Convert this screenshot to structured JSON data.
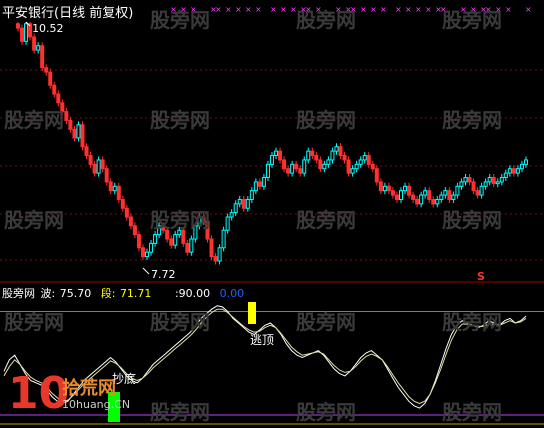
{
  "window": {
    "title": "平安银行(日线 前复权)"
  },
  "watermark": {
    "text": "股旁网"
  },
  "price_pane": {
    "high_label": "10.52",
    "low_label": "7.72",
    "marker_symbol": "S"
  },
  "indicator_bar": {
    "name": "股旁网",
    "wave_label": "波:",
    "wave_value": "75.70",
    "segment_label": "段:",
    "segment_value": "71.71",
    "level_high": ":90.00",
    "level_low": "0.00"
  },
  "annotations": {
    "top_signal": "逃顶",
    "bottom_signal": "抄底"
  },
  "brand": {
    "number": "10",
    "name": "拾荒网",
    "url": "10huang.CN"
  },
  "colors": {
    "background": "#000000",
    "up_candle": "#00ffff",
    "down_candle": "#ff3030",
    "separator": "#a00000",
    "level_line": "#c040ff",
    "wave_line": "#ffffff",
    "segment_line": "#e0e0a0",
    "top_marker": "#ffff00",
    "bottom_marker": "#00ff00",
    "dates_marker": "#ff40ff",
    "level_low_color": "#2060ff"
  },
  "chart_data": [
    {
      "type": "candlestick",
      "y_high": 10.52,
      "y_low": 7.72,
      "closes": [
        10.45,
        10.3,
        10.5,
        10.35,
        10.2,
        10.25,
        10.0,
        9.95,
        9.8,
        9.7,
        9.6,
        9.5,
        9.4,
        9.3,
        9.2,
        9.35,
        9.1,
        9.0,
        8.9,
        8.8,
        8.95,
        8.85,
        8.7,
        8.6,
        8.65,
        8.5,
        8.4,
        8.3,
        8.2,
        8.1,
        7.95,
        7.85,
        7.9,
        8.0,
        8.1,
        8.2,
        8.15,
        8.05,
        7.98,
        8.1,
        8.15,
        8.0,
        7.9,
        8.05,
        8.2,
        8.3,
        8.25,
        8.05,
        7.85,
        7.8,
        7.95,
        8.15,
        8.3,
        8.35,
        8.45,
        8.5,
        8.4,
        8.5,
        8.6,
        8.7,
        8.65,
        8.75,
        8.9,
        9.0,
        9.05,
        8.95,
        8.85,
        8.8,
        8.9,
        8.85,
        8.8,
        8.95,
        9.05,
        9.0,
        8.95,
        8.85,
        8.9,
        8.95,
        9.05,
        9.1,
        9.0,
        8.95,
        8.8,
        8.85,
        8.9,
        8.95,
        9.0,
        8.9,
        8.85,
        8.7,
        8.6,
        8.65,
        8.6,
        8.55,
        8.5,
        8.6,
        8.65,
        8.55,
        8.5,
        8.45,
        8.55,
        8.6,
        8.5,
        8.45,
        8.5,
        8.55,
        8.6,
        8.5,
        8.55,
        8.65,
        8.7,
        8.75,
        8.7,
        8.6,
        8.55,
        8.65,
        8.7,
        8.75,
        8.68,
        8.7,
        8.75,
        8.8,
        8.85,
        8.8,
        8.85,
        8.9,
        8.95
      ]
    },
    {
      "type": "line",
      "ylim": [
        0,
        100
      ],
      "levels": [
        90,
        0
      ],
      "series": [
        {
          "values": [
            38,
            48,
            52,
            44,
            36,
            30,
            28,
            26,
            22,
            16,
            12,
            10,
            12,
            18,
            24,
            30,
            34,
            38,
            42,
            46,
            50,
            46,
            40,
            34,
            30,
            28,
            32,
            38,
            44,
            48,
            52,
            56,
            60,
            64,
            68,
            72,
            78,
            84,
            88,
            92,
            95,
            94,
            90,
            84,
            80,
            76,
            72,
            70,
            74,
            78,
            80,
            76,
            70,
            62,
            56,
            52,
            50,
            52,
            54,
            56,
            52,
            46,
            40,
            36,
            34,
            38,
            44,
            50,
            54,
            56,
            52,
            48,
            40,
            32,
            24,
            18,
            12,
            8,
            6,
            10,
            18,
            30,
            44,
            58,
            70,
            78,
            82,
            80,
            78,
            76,
            78,
            82,
            80,
            78,
            82,
            84,
            80,
            82,
            86
          ]
        },
        {
          "values": [
            34,
            42,
            48,
            44,
            38,
            33,
            30,
            28,
            24,
            19,
            15,
            12,
            13,
            17,
            22,
            27,
            31,
            35,
            39,
            43,
            47,
            45,
            41,
            36,
            32,
            30,
            32,
            36,
            41,
            45,
            49,
            53,
            57,
            61,
            65,
            69,
            74,
            80,
            85,
            89,
            92,
            92,
            89,
            85,
            81,
            77,
            74,
            72,
            73,
            76,
            78,
            76,
            71,
            65,
            59,
            55,
            52,
            53,
            54,
            55,
            53,
            48,
            43,
            39,
            37,
            38,
            42,
            47,
            51,
            53,
            51,
            48,
            42,
            35,
            28,
            22,
            16,
            12,
            10,
            12,
            18,
            28,
            40,
            53,
            65,
            74,
            79,
            79,
            78,
            77,
            77,
            79,
            79,
            78,
            80,
            82,
            80,
            81,
            84
          ]
        }
      ]
    }
  ]
}
